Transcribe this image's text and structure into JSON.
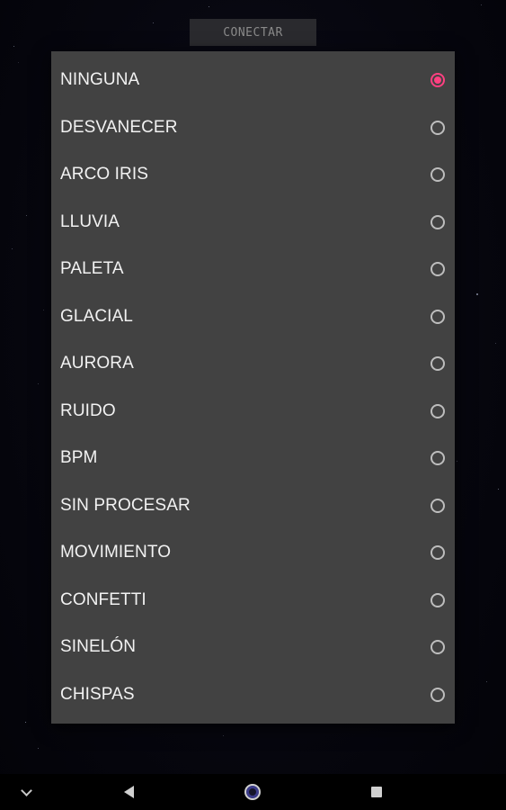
{
  "top_button": {
    "label": "CONECTAR"
  },
  "effects_dialog": {
    "selected_index": 0,
    "options": [
      {
        "label": "NINGUNA",
        "selected": true
      },
      {
        "label": "DESVANECER",
        "selected": false
      },
      {
        "label": "ARCO IRIS",
        "selected": false
      },
      {
        "label": "LLUVIA",
        "selected": false
      },
      {
        "label": "PALETA",
        "selected": false
      },
      {
        "label": "GLACIAL",
        "selected": false
      },
      {
        "label": "AURORA",
        "selected": false
      },
      {
        "label": "RUIDO",
        "selected": false
      },
      {
        "label": "BPM",
        "selected": false
      },
      {
        "label": "SIN PROCESAR",
        "selected": false
      },
      {
        "label": "MOVIMIENTO",
        "selected": false
      },
      {
        "label": "CONFETTI",
        "selected": false
      },
      {
        "label": "SINELÓN",
        "selected": false
      },
      {
        "label": "CHISPAS",
        "selected": false
      }
    ]
  },
  "navigation_bar": {
    "icons": [
      "chevron-down-icon",
      "back-icon",
      "home-icon",
      "recents-icon"
    ]
  },
  "colors": {
    "accent": "#ff4081",
    "dialog_background": "#424242",
    "screen_background": "#05050c",
    "button_background": "#2a2a2e"
  }
}
